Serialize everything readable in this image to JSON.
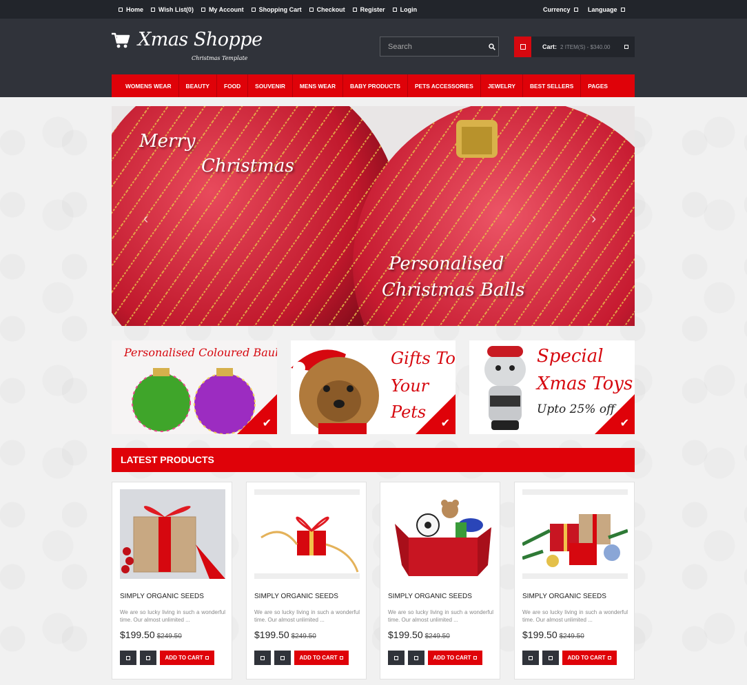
{
  "topbar": {
    "links": [
      "Home",
      "Wish List(0)",
      "My Account",
      "Shopping Cart",
      "Checkout",
      "Register",
      "Login"
    ],
    "currency": "Currency",
    "language": "Language"
  },
  "header": {
    "logo_title": "Xmas Shoppe",
    "logo_subtitle": "Christmas Template",
    "search_placeholder": "Search",
    "search_icon": "search-icon",
    "cart_label": "Cart:",
    "cart_items": "2 ITEM(S) - $340.00"
  },
  "nav": {
    "items": [
      "WOMENS WEAR",
      "BEAUTY",
      "FOOD",
      "SOUVENIR",
      "MENS WEAR",
      "BABY PRODUCTS",
      "PETS ACCESSORIES",
      "JEWELRY",
      "BEST SELLERS",
      "PAGES"
    ]
  },
  "banner": {
    "line1": "Merry",
    "line2": "Christmas",
    "line3": "Personalised",
    "line4": "Christmas Balls"
  },
  "promos": [
    {
      "title": "Personalised Coloured Baubles"
    },
    {
      "line1": "Gifts To",
      "line2": "Your",
      "line3": "Pets"
    },
    {
      "line1": "Special",
      "line2": "Xmas Toys",
      "line3": "Upto 25% off"
    }
  ],
  "latest": {
    "title": "LATEST PRODUCTS",
    "products": [
      {
        "name": "SIMPLY ORGANIC SEEDS",
        "desc": "We are so lucky living in such a wonderful time. Our almost unlimited ...",
        "price": "$199.50",
        "old_price": "$249.50",
        "add_label": "ADD TO CART"
      },
      {
        "name": "SIMPLY ORGANIC SEEDS",
        "desc": "We are so lucky living in such a wonderful time. Our almost unlimited ...",
        "price": "$199.50",
        "old_price": "$249.50",
        "add_label": "ADD TO CART"
      },
      {
        "name": "SIMPLY ORGANIC SEEDS",
        "desc": "We are so lucky living in such a wonderful time. Our almost unlimited ...",
        "price": "$199.50",
        "old_price": "$249.50",
        "add_label": "ADD TO CART"
      },
      {
        "name": "SIMPLY ORGANIC SEEDS",
        "desc": "We are so lucky living in such a wonderful time. Our almost unlimited ...",
        "price": "$199.50",
        "old_price": "$249.50",
        "add_label": "ADD TO CART"
      }
    ]
  },
  "colors": {
    "accent": "#df0209",
    "header": "#30333a",
    "topbar": "#22252b"
  }
}
